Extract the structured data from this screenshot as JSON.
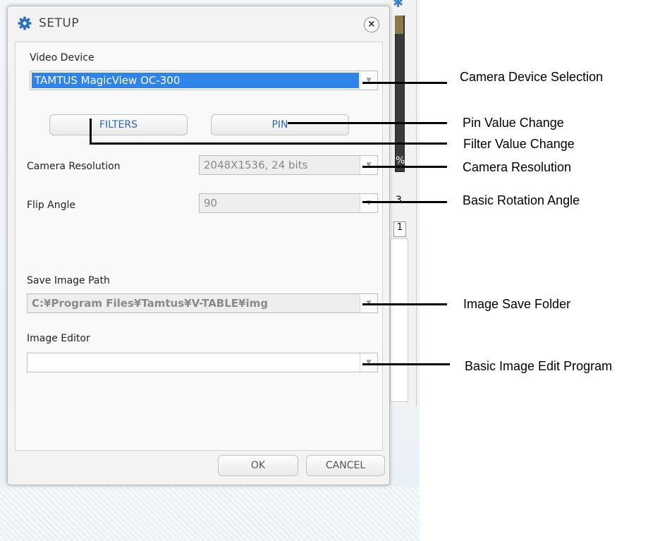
{
  "dialog": {
    "title": "SETUP",
    "close_label": "×",
    "video_device": {
      "label": "Video Device",
      "value": "TAMTUS MagicView OC-300"
    },
    "filters_label": "FILTERS",
    "pin_label": "PIN",
    "camera_resolution": {
      "label": "Camera Resolution",
      "value": "2048X1536, 24 bits"
    },
    "flip_angle": {
      "label": "Flip Angle",
      "value": "90"
    },
    "save_image_path": {
      "label": "Save Image Path",
      "value": "C:¥Program Files¥Tamtus¥V-TABLE¥img"
    },
    "image_editor": {
      "label": "Image Editor",
      "value": ""
    },
    "ok_label": "OK",
    "cancel_label": "CANCEL"
  },
  "background": {
    "num_3": "3",
    "num_1": "1",
    "percent": "%"
  },
  "annotations": {
    "camera_device": "Camera Device Selection",
    "pin_value": "Pin Value Change",
    "filter_value": "Filter Value Change",
    "camera_resolution": "Camera Resolution",
    "rotation_angle": "Basic Rotation Angle",
    "image_save_folder": "Image Save Folder",
    "image_edit_program": "Basic Image Edit Program"
  },
  "icons": {
    "title": "gear-icon",
    "close": "close-icon",
    "dropdown": "chevron-down-icon"
  },
  "colors": {
    "accent": "#2e84e8",
    "button_text": "#2e66b8",
    "title_icon": "#2f6fc3"
  }
}
